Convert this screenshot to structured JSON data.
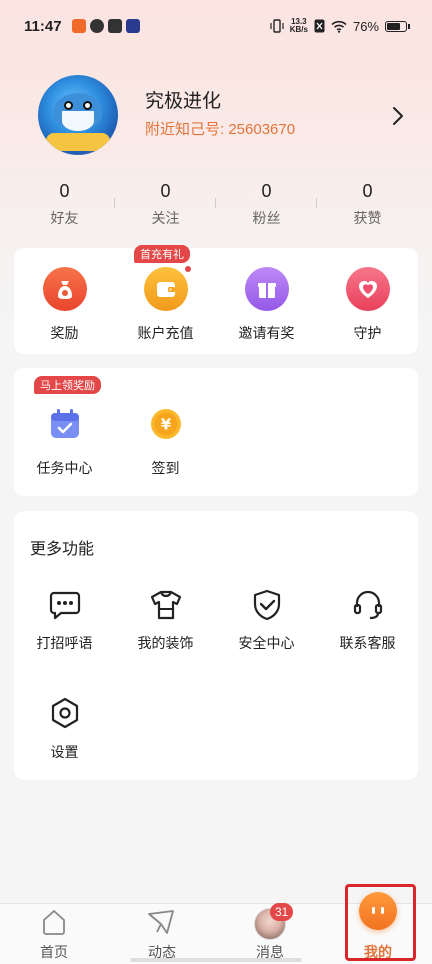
{
  "status_bar": {
    "time": "11:47",
    "net_speed_top": "13.3",
    "net_speed_bottom": "KB/s",
    "battery": "76%"
  },
  "profile": {
    "nickname": "究极进化",
    "uid_label": "附近知己号: 25603670"
  },
  "stats": [
    {
      "value": "0",
      "label": "好友"
    },
    {
      "value": "0",
      "label": "关注"
    },
    {
      "value": "0",
      "label": "粉丝"
    },
    {
      "value": "0",
      "label": "获赞"
    }
  ],
  "quick_actions": {
    "promo_tag": "首充有礼",
    "items": [
      {
        "label": "奖励",
        "icon": "money-bag-icon",
        "color": "#f05a3c"
      },
      {
        "label": "账户充值",
        "icon": "wallet-icon",
        "color": "#f5a623"
      },
      {
        "label": "邀请有奖",
        "icon": "gift-icon",
        "color": "#a66cf0"
      },
      {
        "label": "守护",
        "icon": "heart-icon",
        "color": "#f0506a"
      }
    ]
  },
  "tasks": {
    "promo_tag": "马上领奖励",
    "items": [
      {
        "label": "任务中心",
        "icon": "calendar-check-icon"
      },
      {
        "label": "签到",
        "icon": "yen-coin-icon"
      }
    ]
  },
  "more": {
    "title": "更多功能",
    "items": [
      {
        "label": "打招呼语",
        "icon": "chat-bubble-icon"
      },
      {
        "label": "我的装饰",
        "icon": "tshirt-icon"
      },
      {
        "label": "安全中心",
        "icon": "shield-check-icon"
      },
      {
        "label": "联系客服",
        "icon": "headset-icon"
      },
      {
        "label": "设置",
        "icon": "settings-hexagon-icon"
      }
    ]
  },
  "tabbar": {
    "items": [
      {
        "label": "首页",
        "icon": "home-icon"
      },
      {
        "label": "动态",
        "icon": "paper-plane-icon"
      },
      {
        "label": "消息",
        "icon": "avatar-icon",
        "badge": "31"
      },
      {
        "label": "我的",
        "icon": "face-icon"
      }
    ],
    "active_color": "#e0763d"
  }
}
